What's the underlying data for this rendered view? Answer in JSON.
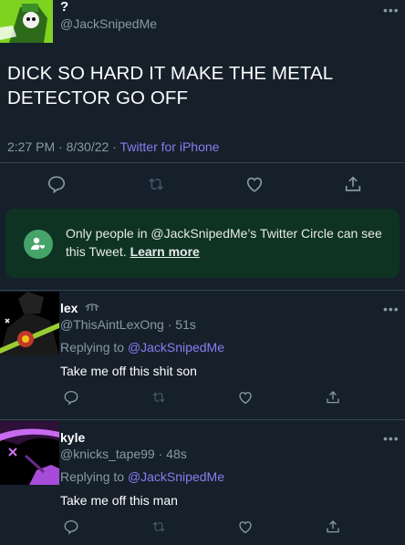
{
  "main_tweet": {
    "name": "?",
    "handle": "@JackSnipedMe",
    "text": "DICK SO HARD IT MAKE THE METAL DETECTOR GO OFF",
    "time": "2:27 PM",
    "date": "8/30/22",
    "source": "Twitter for iPhone",
    "more_icon": "•••"
  },
  "circle_notice": {
    "text": "Only people in @JackSnipedMe’s Twitter Circle can see this Tweet.",
    "link": "Learn more"
  },
  "replies": [
    {
      "name": "lex",
      "handle": "@ThisAintLexOng",
      "age": "51s",
      "replying_prefix": "Replying to",
      "replying_to": "@JackSnipedMe",
      "text": "Take me off this shit son"
    },
    {
      "name": "kyle",
      "handle": "@knicks_tape99",
      "age": "48s",
      "replying_prefix": "Replying to",
      "replying_to": "@JackSnipedMe",
      "text": "Take me off this man"
    }
  ],
  "colors": {
    "background": "#15202b",
    "accent": "#8c7cf0",
    "circle_bg": "#0e3323",
    "circle_icon": "#46a36a",
    "muted": "#8b98a5"
  },
  "icons": [
    "reply-icon",
    "retweet-icon",
    "like-icon",
    "share-icon",
    "more-icon",
    "twitter-circle-icon",
    "verified-hand-icon"
  ]
}
